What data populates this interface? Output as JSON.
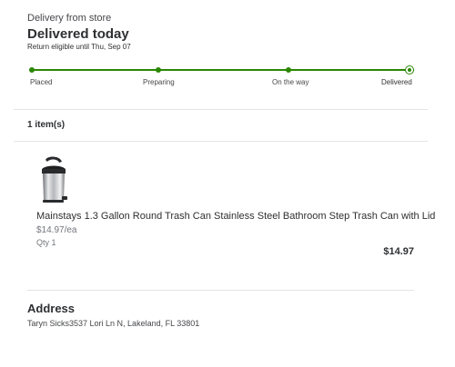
{
  "order": {
    "delivery_label": "Delivery from store",
    "status_title": "Delivered today",
    "return_note": "Return eligible until Thu, Sep 07",
    "tracker": {
      "steps": [
        "Placed",
        "Preparing",
        "On the way",
        "Delivered"
      ],
      "current_step": "Delivered",
      "progress": 1.0,
      "accent_color": "#2a8703"
    }
  },
  "items": {
    "count_label": "1 item(s)",
    "list": [
      {
        "name": "Mainstays 1.3 Gallon Round Trash Can Stainless Steel Bathroom Step Trash Can with Lid",
        "unit_price": "$14.97/ea",
        "quantity": "Qty 1",
        "total": "$14.97",
        "image_icon": "trash-can-product-image"
      }
    ]
  },
  "address": {
    "heading": "Address",
    "text": "Taryn Sicks3537 Lori Ln N, Lakeland, FL 33801"
  }
}
